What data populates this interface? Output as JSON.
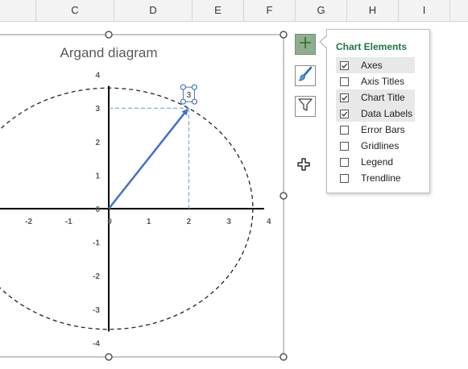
{
  "spreadsheet": {
    "column_headers": [
      "C",
      "D",
      "E",
      "F",
      "G",
      "H",
      "I"
    ]
  },
  "chart": {
    "title": "Argand diagram",
    "data_label": "3"
  },
  "chart_data": {
    "type": "scatter",
    "title": "Argand diagram",
    "xlim": [
      -4,
      4
    ],
    "ylim": [
      -4,
      4
    ],
    "x_ticks": [
      "-2",
      "-1",
      "0",
      "1",
      "2",
      "3",
      "4"
    ],
    "y_ticks": [
      "4",
      "3",
      "2",
      "1",
      "0",
      "-1",
      "-2",
      "-3",
      "-4"
    ],
    "vector": {
      "from": [
        0,
        0
      ],
      "to": [
        2,
        3
      ]
    },
    "data_label": "3",
    "circle_radius": 3.6,
    "grid": false,
    "legend": "none",
    "colors": {
      "vector": "#4472c4",
      "guides": "#5b9bd5",
      "circle": "#222222",
      "axes": "#000000"
    }
  },
  "side_buttons": {
    "elements": {
      "icon": "plus-icon",
      "active": true
    },
    "styles": {
      "icon": "paintbrush-icon"
    },
    "filters": {
      "icon": "funnel-icon"
    }
  },
  "flyout": {
    "title": "Chart Elements",
    "title_color": "#217346",
    "items": [
      {
        "label": "Axes",
        "checked": true
      },
      {
        "label": "Axis Titles",
        "checked": false
      },
      {
        "label": "Chart Title",
        "checked": true
      },
      {
        "label": "Data Labels",
        "checked": true
      },
      {
        "label": "Error Bars",
        "checked": false
      },
      {
        "label": "Gridlines",
        "checked": false
      },
      {
        "label": "Legend",
        "checked": false
      },
      {
        "label": "Trendline",
        "checked": false
      }
    ]
  }
}
